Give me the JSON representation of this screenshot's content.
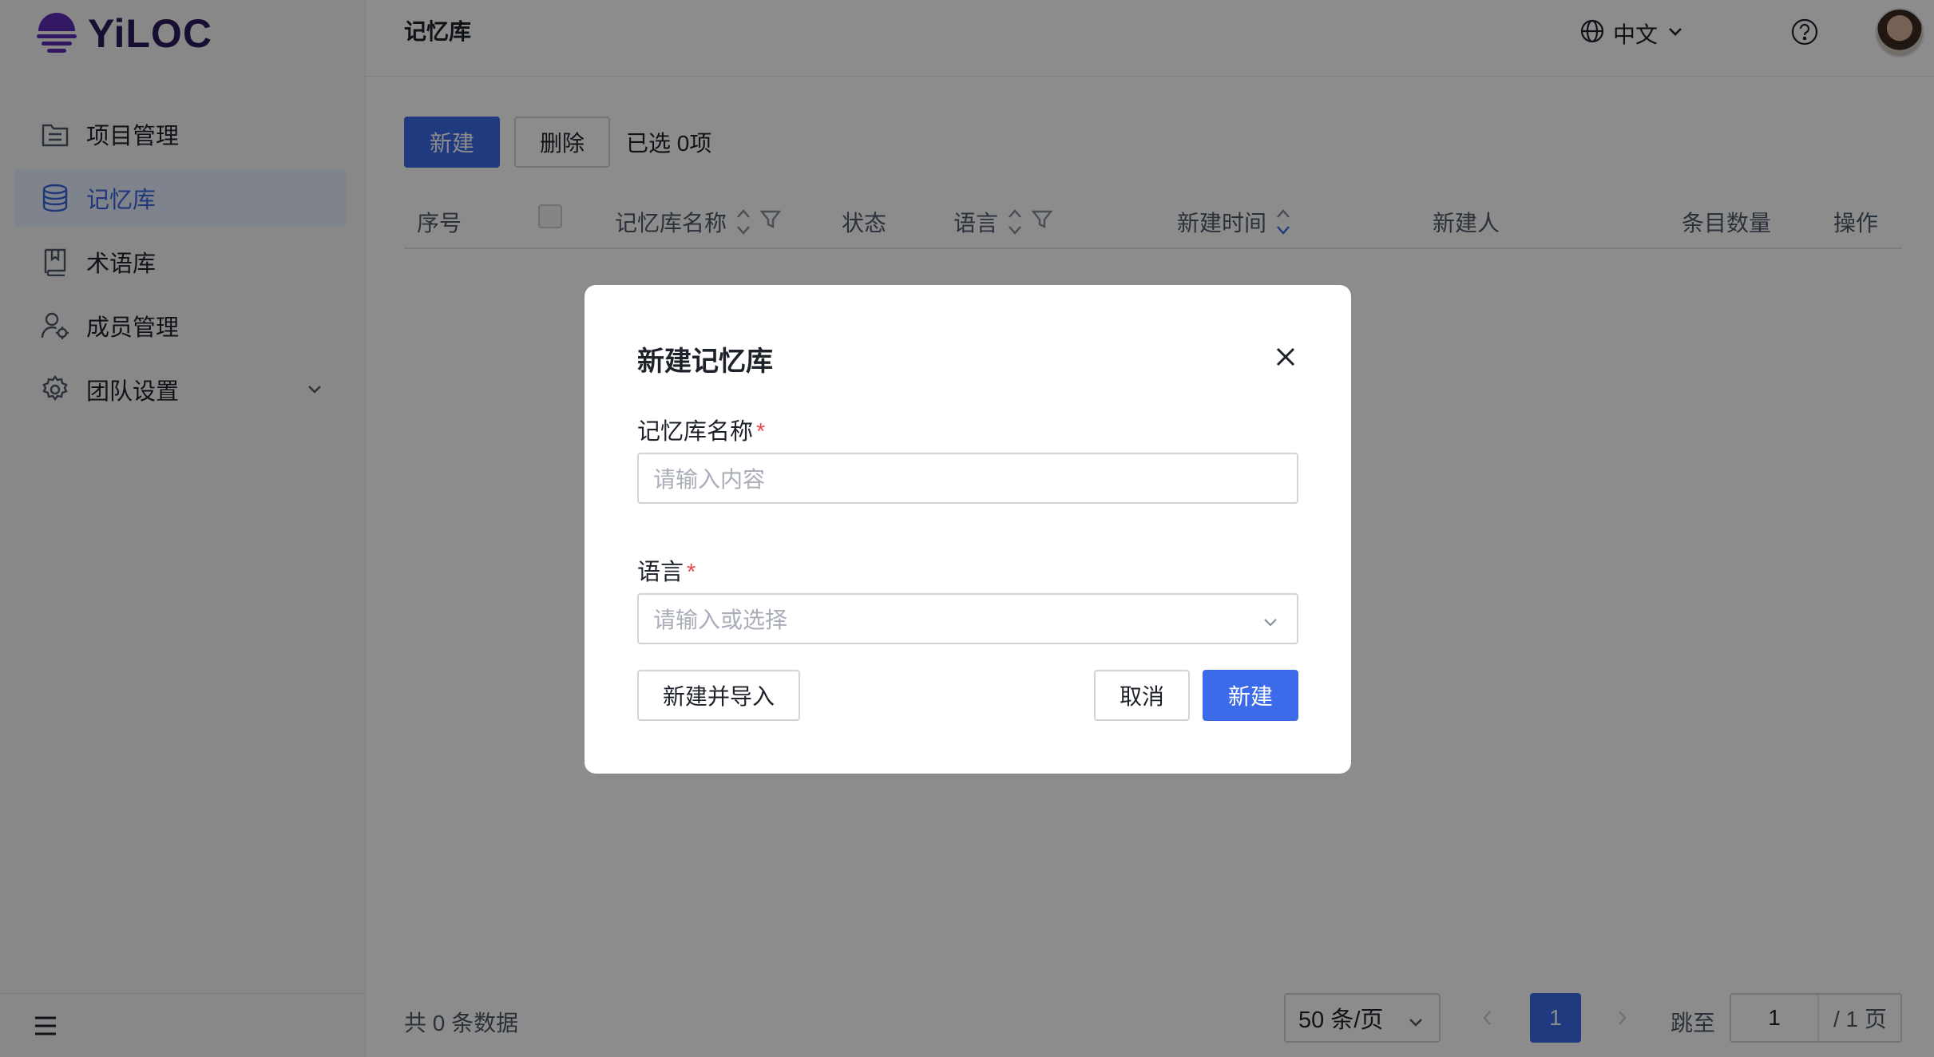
{
  "app": {
    "logo_text": "YiLOC"
  },
  "sidebar": {
    "items": [
      {
        "label": "项目管理",
        "icon": "list-icon"
      },
      {
        "label": "记忆库",
        "icon": "database-icon",
        "active": true
      },
      {
        "label": "术语库",
        "icon": "book-icon"
      },
      {
        "label": "成员管理",
        "icon": "user-settings-icon"
      },
      {
        "label": "团队设置",
        "icon": "gear-icon"
      }
    ]
  },
  "header": {
    "title": "记忆库",
    "language": "中文"
  },
  "toolbar": {
    "new_label": "新建",
    "delete_label": "删除",
    "selected_text": "已选 0项"
  },
  "table": {
    "columns": [
      "序号",
      "记忆库名称",
      "状态",
      "语言",
      "新建时间",
      "新建人",
      "条目数量",
      "操作"
    ]
  },
  "footer": {
    "total_text": "共 0 条数据",
    "page_size": "50 条/页",
    "current_page": "1",
    "jump_label": "跳至",
    "jump_value": "1",
    "total_pages": "/ 1 页"
  },
  "modal": {
    "title": "新建记忆库",
    "name_label": "记忆库名称",
    "name_placeholder": "请输入内容",
    "lang_label": "语言",
    "lang_placeholder": "请输入或选择",
    "required_mark": "*",
    "create_import_label": "新建并导入",
    "cancel_label": "取消",
    "create_label": "新建"
  },
  "colors": {
    "primary": "#3b6be8",
    "logo": "#5b2bb3",
    "active_bg": "#e8efff",
    "required": "#e5484d"
  }
}
